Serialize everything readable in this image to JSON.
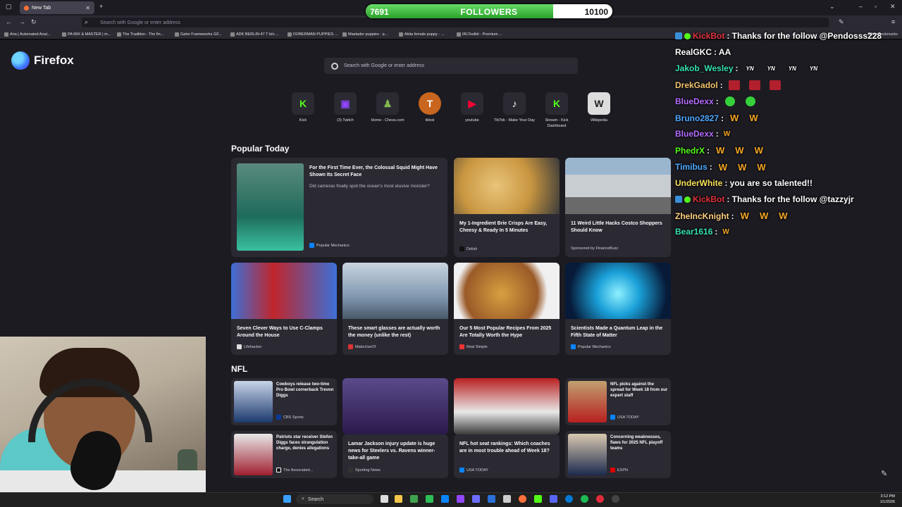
{
  "browser": {
    "tab_title": "New Tab",
    "url_placeholder": "Search with Google or enter address",
    "bookmarks": [
      "Aria | Automated Anal...",
      "PA MIX & MASTER | m...",
      "The Tradition - The fin...",
      "Gator Frameworks GF...",
      "ADK BERLIN-47 T b/o ...",
      "DOBERMAN PUPPIES ...",
      "Mastador puppies - p...",
      "Akita female puppy - ...",
      "IRLToolkit - Premium ..."
    ],
    "other_bookmarks": "Other Bookmarks"
  },
  "newtab": {
    "brand": "Firefox",
    "search_placeholder": "Search with Google or enter address",
    "shortcuts": [
      {
        "label": "Kick",
        "glyph": "K",
        "color": "#53fc18"
      },
      {
        "label": "(3) Twitch",
        "glyph": "▣",
        "color": "#9146ff"
      },
      {
        "label": "Home - Chess.com",
        "glyph": "♟",
        "color": "#81b64c"
      },
      {
        "label": "tiktok",
        "glyph": "T",
        "color": "#e07a2e"
      },
      {
        "label": "youtube",
        "glyph": "▶",
        "color": "#ff0033"
      },
      {
        "label": "TikTok - Make Your Day",
        "glyph": "♪",
        "color": "#ffffff"
      },
      {
        "label": "Stream - Kick Dashboard",
        "glyph": "K",
        "color": "#53fc18"
      },
      {
        "label": "Wikipedia",
        "glyph": "W",
        "color": "#dddddd"
      }
    ],
    "popular_title": "Popular Today",
    "popular": [
      {
        "title": "For the First Time Ever, the Colossal Squid Might Have Shown Its Secret Face",
        "excerpt": "Did cameras finally spot the ocean's most elusive monster?",
        "source": "Popular Mechanics"
      },
      {
        "title": "My 1-Ingredient Brie Crisps Are Easy, Cheesy & Ready In 5 Minutes",
        "source": "Delish"
      },
      {
        "title": "11 Weird Little Hacks Costco Shoppers Should Know",
        "source": "Sponsored by FinanceBuzz"
      },
      {
        "title": "Seven Clever Ways to Use C-Clamps Around the House",
        "source": "Lifehacker"
      },
      {
        "title": "These smart glasses are actually worth the money (unlike the rest)",
        "source": "MakeUseOf"
      },
      {
        "title": "Our 5 Most Popular Recipes From 2025 Are Totally Worth the Hype",
        "source": "Real Simple"
      },
      {
        "title": "Scientists Made a Quantum Leap in the Fifth State of Matter",
        "source": "Popular Mechanics"
      }
    ],
    "nfl_title": "NFL",
    "nfl": [
      {
        "title": "Cowboys release two-time Pro Bowl cornerback Trevon Diggs",
        "source": "CBS Sports"
      },
      {
        "title": "",
        "source": ""
      },
      {
        "title": "",
        "source": ""
      },
      {
        "title": "NFL picks against the spread for Week 18 from our expert staff",
        "source": "USA TODAY"
      },
      {
        "title": "Patriots star receiver Stefon Diggs faces strangulation charge, denies allegations",
        "source": "The Associated..."
      },
      {
        "title": "Lamar Jackson injury update is huge news for Steelers vs. Ravens winner-take-all game",
        "source": "Sporting News"
      },
      {
        "title": "NFL hot seat rankings: Which coaches are in most trouble ahead of Week 18?",
        "source": "USA TODAY"
      },
      {
        "title": "Concerning weaknesses, flaws for 2025 NFL playoff teams",
        "source": "ESPN"
      }
    ]
  },
  "followers": {
    "current": "7691",
    "label": "FOLLOWERS",
    "goal": "10100",
    "progress": 0.76
  },
  "chat": [
    {
      "user": "KickBot",
      "color": "#e0323c",
      "msg": ": Thanks for the follow @Pendosss228",
      "bot": true
    },
    {
      "user": "RealGKC",
      "color": "#ffffff",
      "msg": " : AA"
    },
    {
      "user": "Jakob_Wesley",
      "color": "#36e0b4",
      "msg": " :",
      "emote": "yn"
    },
    {
      "user": "DrekGadol",
      "color": "#f2c46d",
      "msg": " :",
      "emote": "sq"
    },
    {
      "user": "BlueDexx",
      "color": "#b56cff",
      "msg": " :",
      "emote": "green"
    },
    {
      "user": "Bruno2827",
      "color": "#4fa8ff",
      "msg": " :",
      "emote": "w2"
    },
    {
      "user": "BlueDexx",
      "color": "#b56cff",
      "msg": " :",
      "emote": "small"
    },
    {
      "user": "PhedrX",
      "color": "#53fc18",
      "msg": " :",
      "emote": "w3"
    },
    {
      "user": "Timibus",
      "color": "#4fa8ff",
      "msg": " :",
      "emote": "w3"
    },
    {
      "user": "UnderWhite",
      "color": "#f7e35a",
      "msg": " : you are so talented!!"
    },
    {
      "user": "KickBot",
      "color": "#e0323c",
      "msg": ": Thanks for the follow @tazzyjr",
      "bot": true
    },
    {
      "user": "ZheIncKnight",
      "color": "#ffd080",
      "msg": " :",
      "emote": "w3"
    },
    {
      "user": "Bear1616",
      "color": "#36e0b4",
      "msg": " :",
      "emote": "small"
    }
  ],
  "taskbar": {
    "search_label": "Search",
    "time": "3:12 PM",
    "date": "1/1/2026"
  }
}
